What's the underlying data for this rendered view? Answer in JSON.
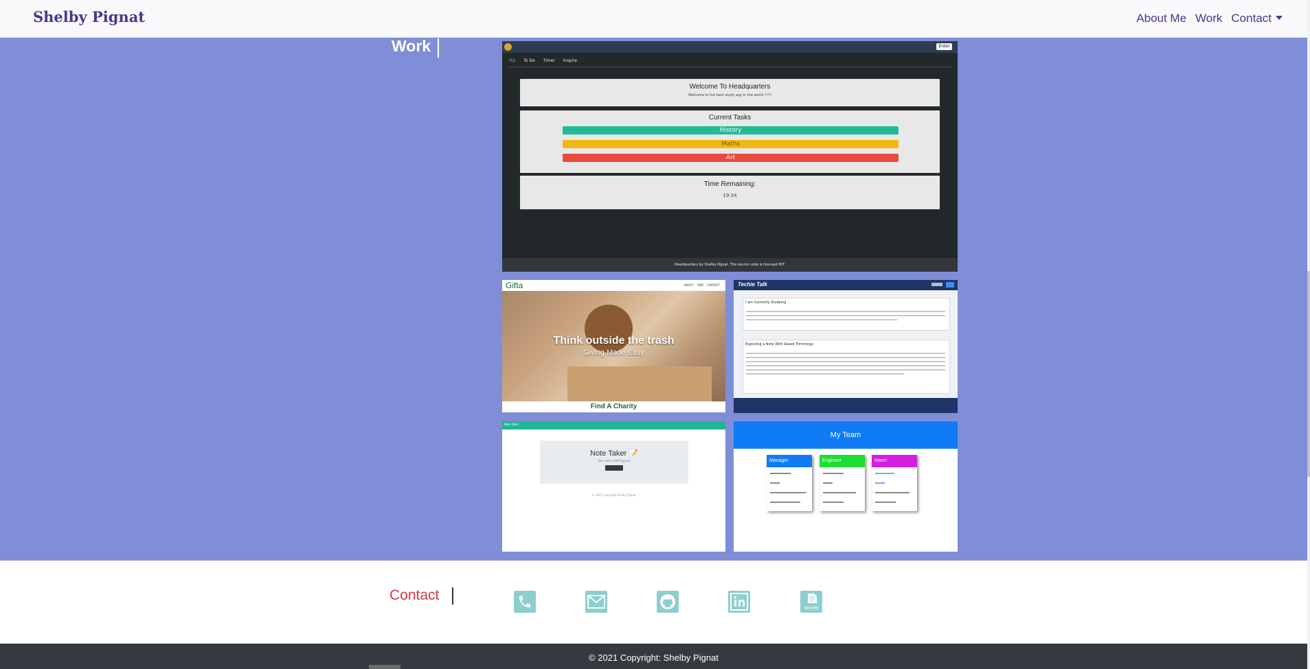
{
  "nav": {
    "brand": "Shelby Pignat",
    "links": [
      "About Me",
      "Work",
      "Contact"
    ]
  },
  "work": {
    "title": "Work",
    "projects": {
      "hq": {
        "tabs": [
          "HQ",
          "To Do",
          "Timer",
          "Inspire"
        ],
        "welcome_title": "Welcome To Headquarters",
        "welcome_sub": "Welcome to the best study app in the world !!!!!",
        "tasks_title": "Current Tasks",
        "tasks": [
          "History",
          "Maths",
          "Art"
        ],
        "time_title": "Time Remaining:",
        "time_value": "19:34",
        "footer": "Headquarters by Shelby Pignat. The source code is licensed MIT."
      },
      "gifta": {
        "logo": "Gifta",
        "nav": [
          "ABOUT",
          "FIND",
          "CONTACT"
        ],
        "headline": "Think outside the trash",
        "subline": "Giving Made Easy",
        "cta": "Find A Charity"
      },
      "techie": {
        "logo": "Techie Talk",
        "post1_title": "I am Currently Studying",
        "post2_title": "Exploring a Note With Sweet Trimmings"
      },
      "note": {
        "bar": "Note Taker",
        "title": "Note Taker 📝",
        "sub": "Take notes with Express",
        "foot": "© 2021 copyright Shelby Pignat"
      },
      "team": {
        "title": "My Team",
        "roles": [
          "Manager",
          "Engineer",
          "Intern"
        ]
      }
    }
  },
  "contact": {
    "title": "Contact",
    "icons": [
      "phone-icon",
      "email-icon",
      "github-icon",
      "linkedin-icon",
      "resume-icon"
    ]
  },
  "footer": {
    "copyright": "© 2021 Copyright: Shelby Pignat"
  },
  "colors": {
    "page_bg": "#7f8ed6",
    "brand": "#4a3590",
    "contact_title": "#dc3545",
    "icon_bg": "#8ccfce",
    "footer_bg": "#343a40"
  }
}
